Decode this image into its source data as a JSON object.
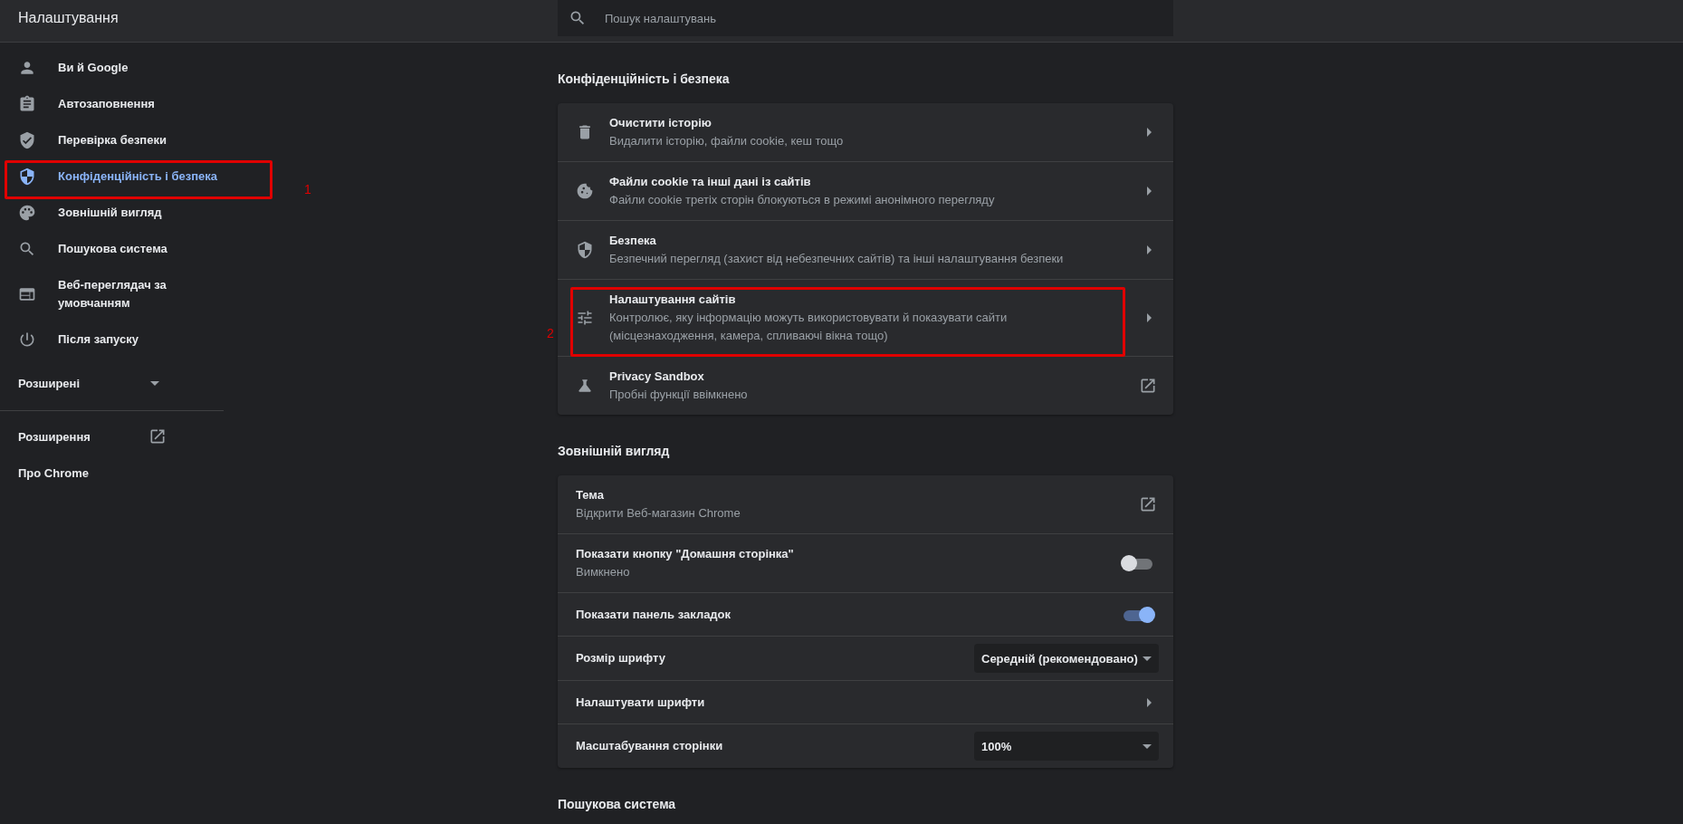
{
  "header": {
    "title": "Налаштування"
  },
  "search": {
    "placeholder": "Пошук налаштувань"
  },
  "sidebar": {
    "items": [
      {
        "label": "Ви й Google",
        "selected": false
      },
      {
        "label": "Автозаповнення",
        "selected": false
      },
      {
        "label": "Перевірка безпеки",
        "selected": false
      },
      {
        "label": "Конфіденційність і безпека",
        "selected": true,
        "callout": "1"
      },
      {
        "label": "Зовнішній вигляд",
        "selected": false
      },
      {
        "label": "Пошукова система",
        "selected": false
      },
      {
        "label": "Веб-переглядач за умовчанням",
        "selected": false
      },
      {
        "label": "Після запуску",
        "selected": false
      }
    ],
    "advanced": {
      "label": "Розширені",
      "expanded": false
    },
    "links": [
      {
        "label": "Розширення",
        "kind": "external"
      },
      {
        "label": "Про Chrome",
        "kind": "plain"
      }
    ]
  },
  "sections": [
    {
      "title": "Конфіденційність і безпека",
      "rows": [
        {
          "kind": "arrow",
          "label": "Очистити історію",
          "description": "Видалити історію, файли cookie, кеш тощо"
        },
        {
          "kind": "arrow",
          "label": "Файли cookie та інші дані із сайтів",
          "description": "Файли cookie третіх сторін блокуються в режимі анонімного перегляду"
        },
        {
          "kind": "arrow",
          "label": "Безпека",
          "description": "Безпечний перегляд (захист від небезпечних сайтів) та інші налаштування безпеки"
        },
        {
          "kind": "arrow",
          "label": "Налаштування сайтів",
          "description": "Контролює, яку інформацію можуть використовувати й показувати сайти\n(місцезнаходження, камера, спливаючі вікна тощо)",
          "callout": "2"
        },
        {
          "kind": "external",
          "label": "Privacy Sandbox",
          "description": "Пробні функції ввімкнено"
        }
      ]
    },
    {
      "title": "Зовнішній вигляд",
      "rows": [
        {
          "kind": "external",
          "label": "Тема",
          "description": "Відкрити Веб-магазин Chrome"
        },
        {
          "kind": "toggle",
          "label": "Показати кнопку \"Домашня сторінка\"",
          "description": "Вимкнено",
          "on": false
        },
        {
          "kind": "toggle",
          "label": "Показати панель закладок",
          "on": true
        },
        {
          "kind": "select",
          "label": "Розмір шрифту",
          "value": "Середній (рекомендовано)"
        },
        {
          "kind": "arrow",
          "label": "Налаштувати шрифти"
        },
        {
          "kind": "select",
          "label": "Масштабування сторінки",
          "value": "100%"
        }
      ]
    },
    {
      "title": "Пошукова система"
    }
  ]
}
